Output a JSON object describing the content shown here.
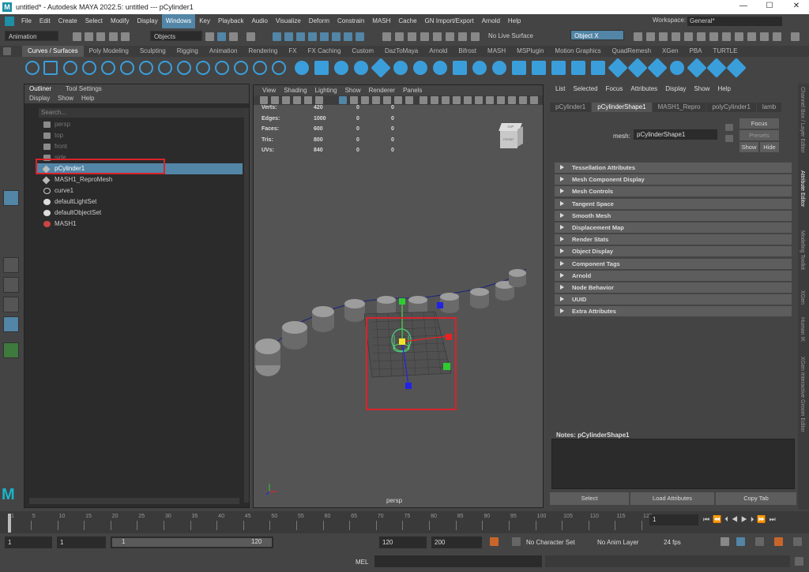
{
  "window": {
    "title": "untitled* - Autodesk MAYA 2022.5: untitled  ---  pCylinder1",
    "logo_letter": "M",
    "min": "—",
    "max": "☐",
    "close": "✕"
  },
  "menubar": {
    "items": [
      "File",
      "Edit",
      "Create",
      "Select",
      "Modify",
      "Display",
      "Windows",
      "Key",
      "Playback",
      "Audio",
      "Visualize",
      "Deform",
      "Constrain",
      "MASH",
      "Cache",
      "GN Import/Export",
      "Arnold",
      "Help"
    ],
    "active": "Windows"
  },
  "workspace": {
    "label": "Workspace:",
    "value": "General*"
  },
  "statusline": {
    "menuset": "Animation",
    "selection_mask": "Objects",
    "live_surface": "No Live Surface",
    "object_field": "Object X"
  },
  "shelf": {
    "tabs": [
      "Curves / Surfaces",
      "Poly Modeling",
      "Sculpting",
      "Rigging",
      "Animation",
      "Rendering",
      "FX",
      "FX Caching",
      "Custom",
      "DazToMaya",
      "Arnold",
      "Bifrost",
      "MASH",
      "MSPlugin",
      "Motion Graphics",
      "QuadRemesh",
      "XGen",
      "PBA",
      "TURTLE"
    ],
    "active": "Curves / Surfaces"
  },
  "outliner": {
    "tabs": [
      "Outliner",
      "Tool Settings"
    ],
    "menu": [
      "Display",
      "Show",
      "Help"
    ],
    "search_placeholder": "Search...",
    "items": [
      {
        "label": "persp",
        "icon": "camera-icon",
        "dim": true
      },
      {
        "label": "top",
        "icon": "camera-icon",
        "dim": true
      },
      {
        "label": "front",
        "icon": "camera-icon",
        "dim": true
      },
      {
        "label": "side",
        "icon": "camera-icon",
        "dim": true
      },
      {
        "label": "pCylinder1",
        "icon": "mesh-icon",
        "selected": true
      },
      {
        "label": "MASH1_ReproMesh",
        "icon": "mesh-icon"
      },
      {
        "label": "curve1",
        "icon": "curve-icon"
      },
      {
        "label": "defaultLightSet",
        "icon": "set-icon"
      },
      {
        "label": "defaultObjectSet",
        "icon": "set-icon"
      },
      {
        "label": "MASH1",
        "icon": "mash-icon"
      }
    ]
  },
  "viewport": {
    "menu": [
      "View",
      "Shading",
      "Lighting",
      "Show",
      "Renderer",
      "Panels"
    ],
    "camera": "persp",
    "stats": [
      {
        "label": "Verts:",
        "v1": "420",
        "v2": "0",
        "v3": "0"
      },
      {
        "label": "Edges:",
        "v1": "1000",
        "v2": "0",
        "v3": "0"
      },
      {
        "label": "Faces:",
        "v1": "600",
        "v2": "0",
        "v3": "0"
      },
      {
        "label": "Tris:",
        "v1": "800",
        "v2": "0",
        "v3": "0"
      },
      {
        "label": "UVs:",
        "v1": "840",
        "v2": "0",
        "v3": "0"
      }
    ],
    "viewcube_top": "TOP",
    "viewcube_front": "FRONT"
  },
  "attribute_editor": {
    "menu": [
      "List",
      "Selected",
      "Focus",
      "Attributes",
      "Display",
      "Show",
      "Help"
    ],
    "tabs": [
      "pCylinder1",
      "pCylinderShape1",
      "MASH1_Repro",
      "polyCylinder1",
      "lamb"
    ],
    "active_tab": "pCylinderShape1",
    "mesh_label": "mesh:",
    "mesh_value": "pCylinderShape1",
    "focus": "Focus",
    "presets": "Presets",
    "show": "Show",
    "hide": "Hide",
    "sections": [
      "Tessellation Attributes",
      "Mesh Component Display",
      "Mesh Controls",
      "Tangent Space",
      "Smooth Mesh",
      "Displacement Map",
      "Render Stats",
      "Object Display",
      "Component Tags",
      "Arnold",
      "Node Behavior",
      "UUID",
      "Extra Attributes"
    ],
    "notes": "Notes:  pCylinderShape1",
    "buttons": [
      "Select",
      "Load Attributes",
      "Copy Tab"
    ]
  },
  "right_tabs": [
    "Channel Box / Layer Editor",
    "Attribute Editor",
    "Modeling Toolkit",
    "XGen",
    "Human IK",
    "XGen Interactive Groom Editor"
  ],
  "timeline": {
    "ticks": [
      "1",
      "5",
      "10",
      "15",
      "20",
      "25",
      "30",
      "35",
      "40",
      "45",
      "50",
      "55",
      "60",
      "65",
      "70",
      "75",
      "80",
      "85",
      "90",
      "95",
      "100",
      "105",
      "110",
      "115",
      "120"
    ],
    "current": "1"
  },
  "range": {
    "start": "1",
    "start2": "1",
    "slider_start": "1",
    "slider_end": "120",
    "end": "120",
    "end2": "200",
    "character_set": "No Character Set",
    "anim_layer": "No Anim Layer",
    "fps": "24 fps"
  },
  "cmdline": {
    "label": "MEL"
  }
}
